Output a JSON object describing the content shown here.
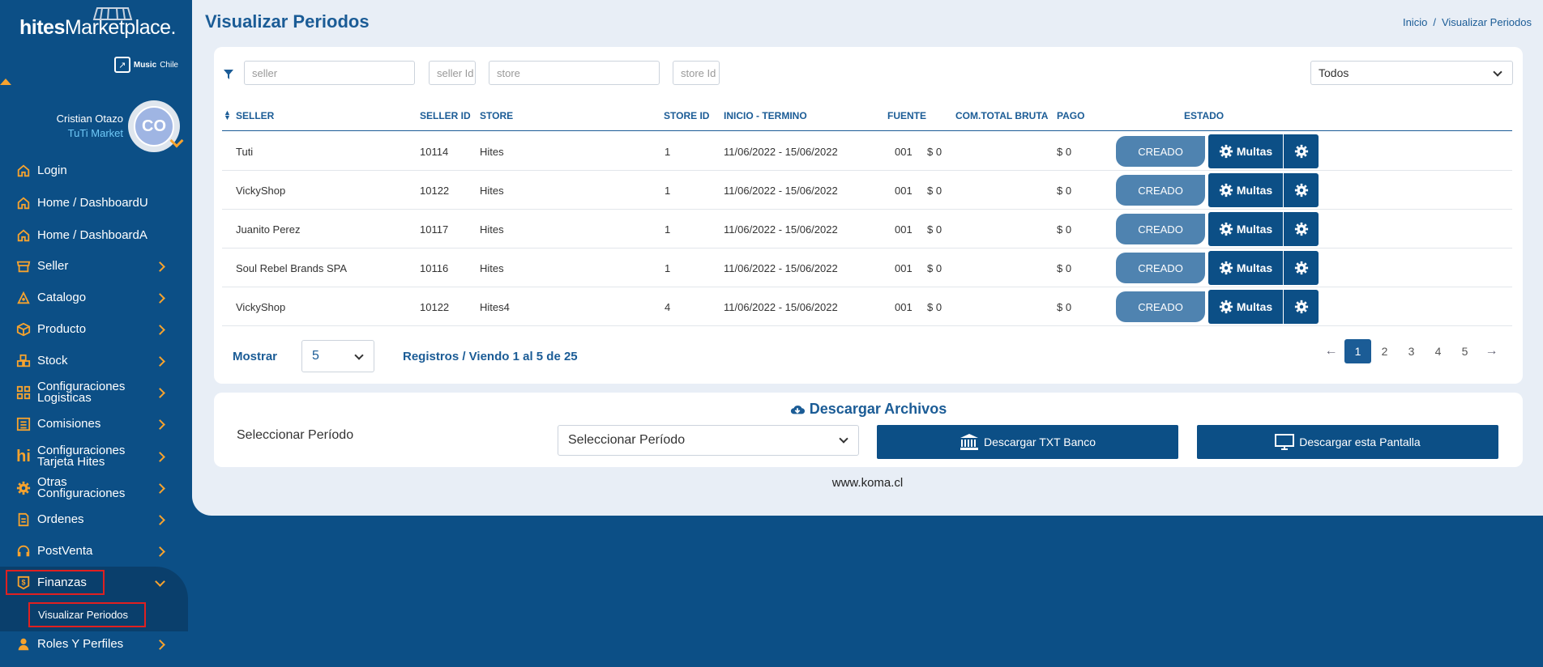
{
  "brand": {
    "logo_bold": "hites",
    "logo_light": "Marketplace.",
    "badge_bold": "Music",
    "badge_light": "Chile"
  },
  "user": {
    "name": "Cristian Otazo",
    "store": "TuTi Market",
    "initials": "CO"
  },
  "sidebar": {
    "items": [
      {
        "label": "Login",
        "icon": "home-icon"
      },
      {
        "label": "Home / DashboardU",
        "icon": "home-icon"
      },
      {
        "label": "Home / DashboardA",
        "icon": "home-icon"
      },
      {
        "label": "Seller",
        "icon": "store-icon"
      },
      {
        "label": "Catalogo",
        "icon": "paint-icon"
      },
      {
        "label": "Producto",
        "icon": "box-icon"
      },
      {
        "label": "Stock",
        "icon": "boxes-icon"
      },
      {
        "label": "Configuraciones Logisticas",
        "icon": "grid-icon"
      },
      {
        "label": "Comisiones",
        "icon": "list-icon"
      },
      {
        "label": "Configuraciones Tarjeta Hites",
        "icon": "hites-icon"
      },
      {
        "label": "Otras Configuraciones",
        "icon": "gear-icon"
      },
      {
        "label": "Ordenes",
        "icon": "document-icon"
      },
      {
        "label": "PostVenta",
        "icon": "headset-icon"
      },
      {
        "label": "Finanzas",
        "icon": "finance-icon"
      },
      {
        "label": "Roles Y Perfiles",
        "icon": "user-icon"
      }
    ],
    "subitem": "Visualizar Periodos"
  },
  "header": {
    "title": "Visualizar Periodos",
    "breadcrumb": [
      "Inicio",
      "Visualizar Periodos"
    ]
  },
  "filters": {
    "seller": "seller",
    "seller_id": "seller Id",
    "store": "store",
    "store_id": "store Id",
    "estado_select": "Todos"
  },
  "table": {
    "headers": [
      "SELLER",
      "SELLER ID",
      "STORE",
      "STORE ID",
      "INICIO - TERMINO",
      "FUENTE",
      "COM.TOTAL BRUTA",
      "PAGO",
      "ESTADO"
    ],
    "rows": [
      {
        "seller": "Tuti",
        "seller_id": "10114",
        "store": "Hites",
        "store_id": "1",
        "period": "11/06/2022 - 15/06/2022",
        "fuente": "001",
        "com": "$ 0",
        "pago": "$ 0",
        "estado": "CREADO",
        "multas": "Multas"
      },
      {
        "seller": "VickyShop",
        "seller_id": "10122",
        "store": "Hites",
        "store_id": "1",
        "period": "11/06/2022 - 15/06/2022",
        "fuente": "001",
        "com": "$ 0",
        "pago": "$ 0",
        "estado": "CREADO",
        "multas": "Multas"
      },
      {
        "seller": "Juanito Perez",
        "seller_id": "10117",
        "store": "Hites",
        "store_id": "1",
        "period": "11/06/2022 - 15/06/2022",
        "fuente": "001",
        "com": "$ 0",
        "pago": "$ 0",
        "estado": "CREADO",
        "multas": "Multas"
      },
      {
        "seller": "Soul Rebel Brands SPA",
        "seller_id": "10116",
        "store": "Hites",
        "store_id": "1",
        "period": "11/06/2022 - 15/06/2022",
        "fuente": "001",
        "com": "$ 0",
        "pago": "$ 0",
        "estado": "CREADO",
        "multas": "Multas"
      },
      {
        "seller": "VickyShop",
        "seller_id": "10122",
        "store": "Hites4",
        "store_id": "4",
        "period": "11/06/2022 - 15/06/2022",
        "fuente": "001",
        "com": "$ 0",
        "pago": "$ 0",
        "estado": "CREADO",
        "multas": "Multas"
      }
    ]
  },
  "pagination": {
    "mostrar_label": "Mostrar",
    "page_size": "5",
    "summary": "Registros / Viendo 1 al 5 de 25",
    "pages": [
      "1",
      "2",
      "3",
      "4",
      "5"
    ],
    "active_page": "1"
  },
  "downloads": {
    "title": "Descargar Archivos",
    "periodo_label": "Seleccionar Período",
    "periodo_placeholder": "Seleccionar Período",
    "txt_button": "Descargar TXT Banco",
    "screen_button": "Descargar esta Pantalla"
  },
  "footer": {
    "url": "www.koma.cl"
  },
  "colors": {
    "primary": "#0c4f86",
    "accent": "#f7a32e",
    "estado": "#4f83b0",
    "highlight": "#e02020"
  }
}
